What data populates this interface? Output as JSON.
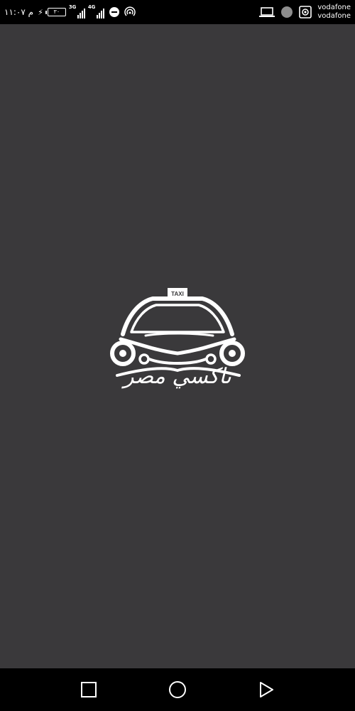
{
  "status_bar": {
    "time": "م ١١:٠٧",
    "battery_level": "٣٠",
    "network_1": "3G",
    "network_2": "4G",
    "carrier_1": "vodafone",
    "carrier_2": "vodafone",
    "icons": [
      "charging-icon",
      "battery-icon",
      "signal-3g-icon",
      "signal-4g-icon",
      "do-not-disturb-icon",
      "hotspot-icon",
      "laptop-icon",
      "circle-status-icon",
      "screen-record-icon"
    ]
  },
  "splash": {
    "taxi_sign": "TAXI",
    "brand_name": "تاكسي مصر"
  },
  "nav_bar": {
    "icons": [
      "recent-apps-icon",
      "home-icon",
      "back-icon"
    ]
  },
  "colors": {
    "background": "#3a393b",
    "bars": "#000000",
    "foreground": "#ffffff"
  }
}
